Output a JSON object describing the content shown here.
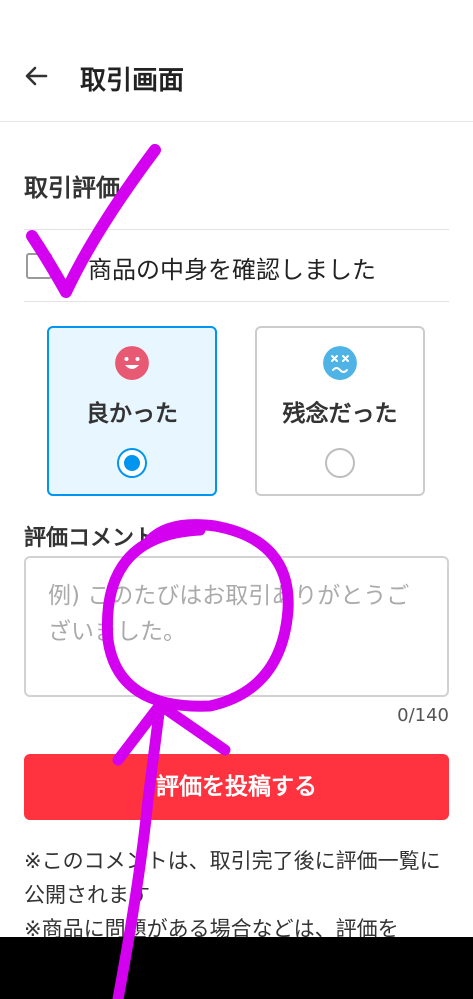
{
  "header": {
    "title": "取引画面",
    "back_icon": "arrow-left-icon"
  },
  "section": {
    "title": "取引評価"
  },
  "confirm": {
    "label": "商品の中身を確認しました",
    "checked": false
  },
  "ratings": [
    {
      "label": "良かった",
      "icon": "smile-face-icon",
      "color": "#e85a74",
      "selected": true
    },
    {
      "label": "残念だった",
      "icon": "sad-face-icon",
      "color": "#4fb3e6",
      "selected": false
    }
  ],
  "comment": {
    "title": "評価コメント",
    "placeholder": "例) このたびはお取引ありがとうございました。",
    "counter": "0/140"
  },
  "submit": {
    "label": "評価を投稿する"
  },
  "notes": [
    "※このコメントは、取引完了後に評価一覧に公開されます",
    "※商品に問題がある場合などは、評価を"
  ],
  "colors": {
    "accent": "#0095ee",
    "submit": "#ff333f",
    "annotation": "#d400f0"
  }
}
